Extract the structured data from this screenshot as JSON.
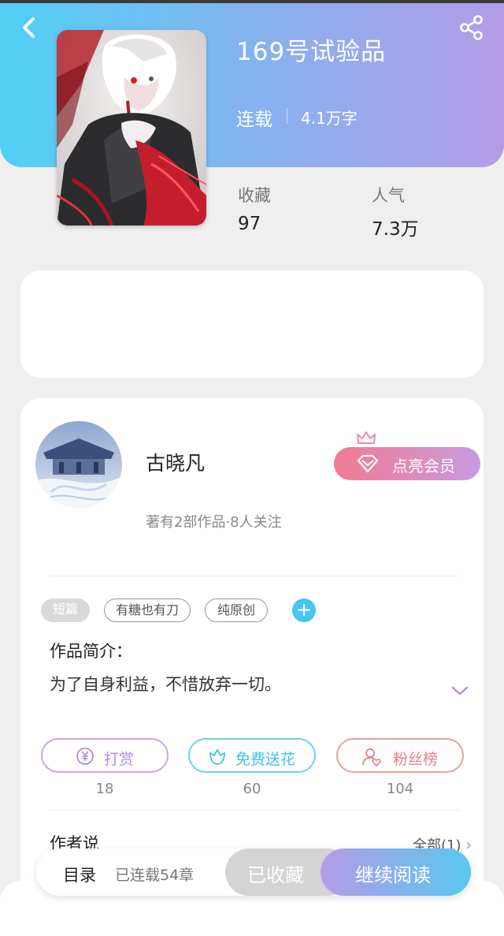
{
  "book": {
    "title": "169号试验品",
    "status": "连载",
    "word_count": "4.1万字",
    "stats": {
      "favorites_label": "收藏",
      "favorites_value": "97",
      "popularity_label": "人气",
      "popularity_value": "7.3万"
    }
  },
  "author": {
    "name": "古晓凡",
    "meta": "著有2部作品·8人关注",
    "vip_button": "点亮会员"
  },
  "tags": [
    "短篇",
    "有糖也有刀",
    "纯原创"
  ],
  "intro": {
    "heading": "作品简介：",
    "text": "为了自身利益，不惜放弃一切。"
  },
  "actions": [
    {
      "label": "打赏",
      "count": "18",
      "icon": "yen-icon",
      "color": "#b58ad8"
    },
    {
      "label": "免费送花",
      "count": "60",
      "icon": "flower-icon",
      "color": "#3fc1e8"
    },
    {
      "label": "粉丝榜",
      "count": "104",
      "icon": "fan-ranking-icon",
      "color": "#e57f86"
    }
  ],
  "author_says": {
    "heading": "作者说",
    "all_label": "全部(1)"
  },
  "bottom_bar": {
    "toc": "目录",
    "serial_info": "已连载54章",
    "favorited": "已收藏",
    "continue_reading": "继续阅读"
  },
  "colors": {
    "header_start": "#4fd0f3",
    "header_end": "#b39ce8",
    "vip_start": "#f27b91",
    "accent_blue": "#45c7f0"
  }
}
